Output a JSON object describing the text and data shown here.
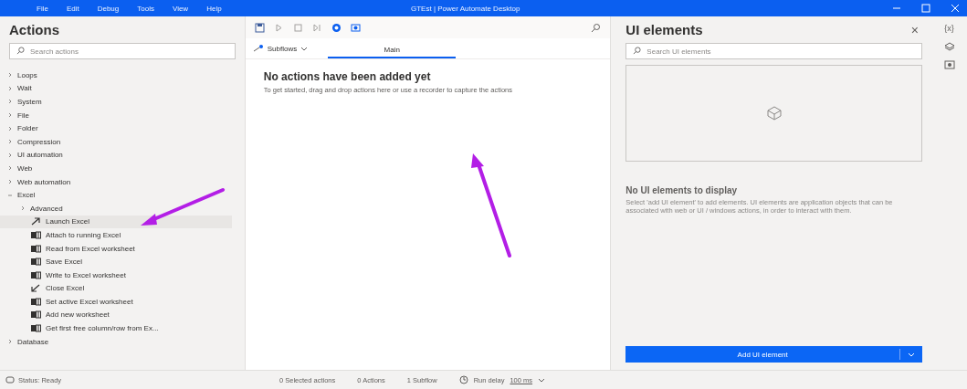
{
  "window": {
    "title": "GTEst | Power Automate Desktop",
    "menu": [
      "File",
      "Edit",
      "Debug",
      "Tools",
      "View",
      "Help"
    ]
  },
  "actions_panel": {
    "title": "Actions",
    "search": {
      "placeholder": "Search actions"
    },
    "tree": [
      {
        "label": "Loops",
        "expanded": false
      },
      {
        "label": "Wait",
        "expanded": false
      },
      {
        "label": "System",
        "expanded": false
      },
      {
        "label": "File",
        "expanded": false
      },
      {
        "label": "Folder",
        "expanded": false
      },
      {
        "label": "Compression",
        "expanded": false
      },
      {
        "label": "UI automation",
        "expanded": false
      },
      {
        "label": "Web",
        "expanded": false
      },
      {
        "label": "Web automation",
        "expanded": false
      },
      {
        "label": "Excel",
        "expanded": true,
        "children": [
          {
            "kind": "group",
            "label": "Advanced",
            "expanded": false
          },
          {
            "kind": "launch",
            "label": "Launch Excel",
            "selected": true
          },
          {
            "kind": "excel",
            "label": "Attach to running Excel",
            "selected": false
          },
          {
            "kind": "excel",
            "label": "Read from Excel worksheet",
            "selected": false
          },
          {
            "kind": "excel",
            "label": "Save Excel",
            "selected": false
          },
          {
            "kind": "excel",
            "label": "Write to Excel worksheet",
            "selected": false
          },
          {
            "kind": "close",
            "label": "Close Excel",
            "selected": false
          },
          {
            "kind": "excel",
            "label": "Set active Excel worksheet",
            "selected": false
          },
          {
            "kind": "excel",
            "label": "Add new worksheet",
            "selected": false
          },
          {
            "kind": "excel",
            "label": "Get first free column/row from Ex...",
            "selected": false
          }
        ]
      },
      {
        "label": "Database",
        "expanded": false
      }
    ]
  },
  "designer": {
    "subflows_label": "Subflows",
    "tabs": [
      {
        "label": "Main",
        "selected": true
      }
    ],
    "empty_title": "No actions have been added yet",
    "empty_text": "To get started, drag and drop actions here or use a recorder to capture the actions"
  },
  "ui_elements_panel": {
    "title": "UI elements",
    "close": "×",
    "search": {
      "placeholder": "Search UI elements"
    },
    "empty_title": "No UI elements to display",
    "empty_text": "Select 'add UI element' to add elements. UI elements are application objects that can be associated with web or UI / windows actions, in order to interact with them.",
    "add_button": "Add UI element"
  },
  "side_rail": {
    "variables_label": "{x}"
  },
  "annotations": [
    {
      "kind": "arrow"
    },
    {
      "kind": "arrow"
    }
  ],
  "status_bar": {
    "status": "Status: Ready",
    "selected_actions": "0 Selected actions",
    "actions": "0 Actions",
    "subflows": "1 Subflow",
    "run_delay_label": "Run delay",
    "run_delay_value": "100 ms"
  }
}
